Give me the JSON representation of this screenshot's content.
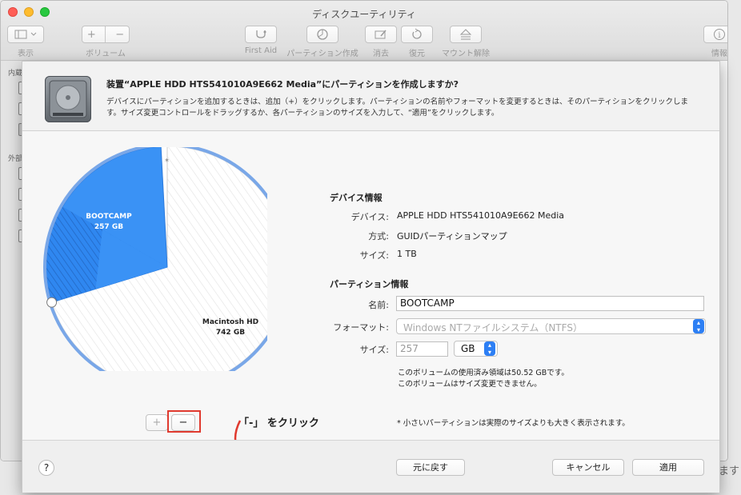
{
  "window": {
    "title": "ディスクユーティリティ",
    "toolbar": {
      "view_label": "表示",
      "volume_label": "ボリューム",
      "volume_add": "+",
      "volume_remove": "−",
      "first_aid_label": "First Aid",
      "partition_label": "パーティション作成",
      "erase_label": "消去",
      "restore_label": "復元",
      "unmount_label": "マウント解除",
      "info_label": "情報"
    },
    "sidebar": {
      "internal_label": "内蔵",
      "external_label": "外部"
    },
    "right_fragment": "ます"
  },
  "sheet": {
    "headline": "装置“APPLE HDD HTS541010A9E662 Media”にパーティションを作成しますか?",
    "description": "デバイスにパーティションを追加するときは、追加（+）をクリックします。パーティションの名前やフォーマットを変更するときは、そのパーティションをクリックします。サイズ変更コントロールをドラッグするか、各パーティションのサイズを入力して、“適用”をクリックします。",
    "pie": {
      "segments": [
        {
          "name": "BOOTCAMP",
          "size": "257 GB",
          "color": "#3a92f5"
        },
        {
          "name": "Macintosh HD",
          "size": "742 GB",
          "color": "#ffffff"
        }
      ],
      "small_marker": "*",
      "add_button": "+",
      "remove_button": "−"
    },
    "annotation": "「-」 をクリック",
    "device_info": {
      "heading": "デバイス情報",
      "rows": [
        {
          "label": "デバイス:",
          "value": "APPLE HDD HTS541010A9E662 Media"
        },
        {
          "label": "方式:",
          "value": "GUIDパーティションマップ"
        },
        {
          "label": "サイズ:",
          "value": "1 TB"
        }
      ]
    },
    "partition_info": {
      "heading": "パーティション情報",
      "name_label": "名前:",
      "name_value": "BOOTCAMP",
      "format_label": "フォーマット:",
      "format_value": "Windows NTファイルシステム（NTFS）",
      "size_label": "サイズ:",
      "size_value": "257",
      "size_unit": "GB",
      "note_line1": "このボリュームの使用済み領域は50.52 GBです。",
      "note_line2": "このボリュームはサイズ変更できません。"
    },
    "footnote": "* 小さいパーティションは実際のサイズよりも大きく表示されます。",
    "buttons": {
      "help": "?",
      "revert": "元に戻す",
      "cancel": "キャンセル",
      "apply": "適用"
    }
  }
}
